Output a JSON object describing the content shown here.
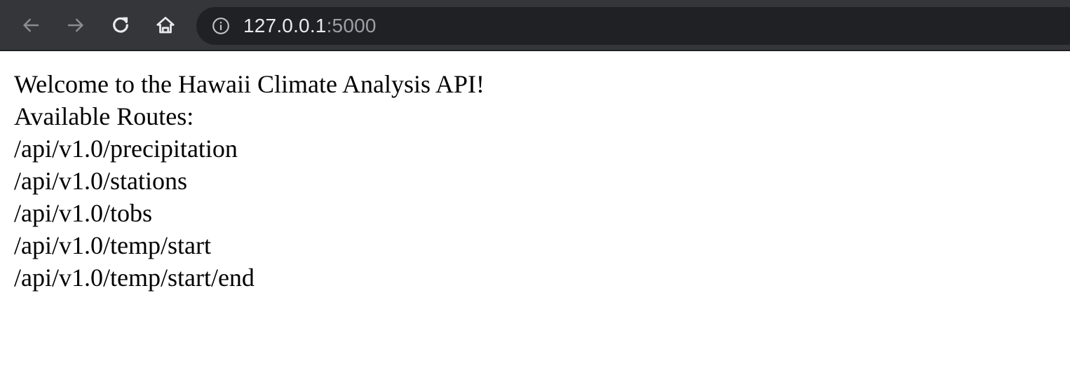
{
  "browser": {
    "url_host": "127.0.0.1",
    "url_port": ":5000",
    "icons": {
      "back": "arrow-left-icon",
      "forward": "arrow-right-icon",
      "reload": "reload-icon",
      "home": "home-icon",
      "site_info": "info-icon"
    }
  },
  "page": {
    "welcome": "Welcome to the Hawaii Climate Analysis API!",
    "routes_heading": "Available Routes:",
    "routes": [
      "/api/v1.0/precipitation",
      "/api/v1.0/stations",
      "/api/v1.0/tobs",
      "/api/v1.0/temp/start",
      "/api/v1.0/temp/start/end"
    ]
  }
}
